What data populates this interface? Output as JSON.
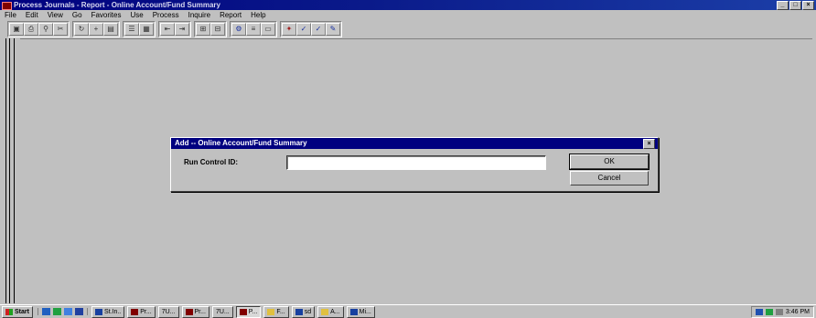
{
  "window": {
    "title": "Process Journals - Report - Online Account/Fund Summary",
    "minimize": "_",
    "maximize": "□",
    "close": "×"
  },
  "menu": [
    "File",
    "Edit",
    "View",
    "Go",
    "Favorites",
    "Use",
    "Process",
    "Inquire",
    "Report",
    "Help"
  ],
  "toolbar_groups": [
    [
      {
        "icon": "save-icon",
        "glyph": "▣"
      },
      {
        "icon": "print-icon",
        "glyph": "⎙"
      },
      {
        "icon": "find-icon",
        "glyph": "⚲"
      },
      {
        "icon": "cut-icon",
        "glyph": "✂"
      }
    ],
    [
      {
        "icon": "update-icon",
        "glyph": "↻"
      },
      {
        "icon": "add-icon",
        "glyph": "+"
      },
      {
        "icon": "display-icon",
        "glyph": "▤"
      }
    ],
    [
      {
        "icon": "list-icon",
        "glyph": "☰"
      },
      {
        "icon": "detail-icon",
        "glyph": "▦"
      }
    ],
    [
      {
        "icon": "prev-icon",
        "glyph": "⇤"
      },
      {
        "icon": "next-icon",
        "glyph": "⇥"
      }
    ],
    [
      {
        "icon": "insert-row-icon",
        "glyph": "⊞"
      },
      {
        "icon": "delete-row-icon",
        "glyph": "⊟"
      }
    ],
    [
      {
        "icon": "process-icon",
        "glyph": "⚙"
      },
      {
        "icon": "refresh-icon",
        "glyph": "≡"
      },
      {
        "icon": "calendar-icon",
        "glyph": "▭"
      }
    ],
    [
      {
        "icon": "navigate-icon",
        "glyph": "✦"
      },
      {
        "icon": "check-icon",
        "glyph": "✓"
      },
      {
        "icon": "approve-icon",
        "glyph": "✓"
      },
      {
        "icon": "pencil-icon",
        "glyph": "✎"
      }
    ]
  ],
  "dialog": {
    "title": "Add -- Online Account/Fund Summary",
    "close": "×",
    "field_label": "Run Control ID:",
    "field_value": "",
    "ok_label": "OK",
    "cancel_label": "Cancel"
  },
  "taskbar": {
    "start_label": "Start",
    "tasks": [
      {
        "label": "St.In..",
        "active": false
      },
      {
        "label": "Pr...",
        "active": false
      },
      {
        "label": "7U...",
        "active": false
      },
      {
        "label": "Pr...",
        "active": false
      },
      {
        "label": "7U...",
        "active": false
      },
      {
        "label": "P...",
        "active": true
      },
      {
        "label": "F...",
        "active": false
      },
      {
        "label": "sd",
        "active": false
      },
      {
        "label": "A...",
        "active": false
      },
      {
        "label": "Mi...",
        "active": false
      }
    ],
    "clock": "3:46 PM"
  },
  "colors": {
    "desktop": "#c0c0c0",
    "title_active": "#000080"
  }
}
